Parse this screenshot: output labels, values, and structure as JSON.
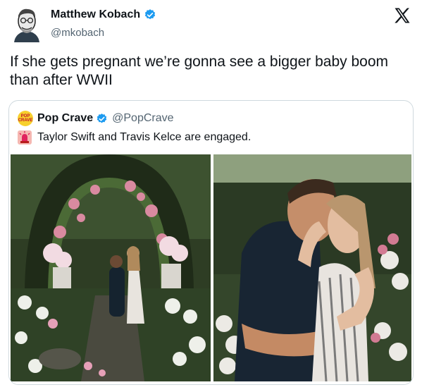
{
  "author": {
    "name": "Matthew Kobach",
    "handle": "@mkobach"
  },
  "tweet": {
    "text": "If she gets pregnant we’re gonna see a bigger baby boom than after WWII"
  },
  "quoted": {
    "avatar_text": "POP CRAVE",
    "name": "Pop Crave",
    "handle": "@PopCrave",
    "text": "Taylor Swift and Travis Kelce are engaged."
  },
  "icons": {
    "verified": "verified-badge-icon",
    "platform": "x-logo-icon",
    "siren": "police-light-icon"
  },
  "colors": {
    "verified_blue": "#1d9bf0",
    "handle_gray": "#536471",
    "border": "#cfd9de"
  }
}
